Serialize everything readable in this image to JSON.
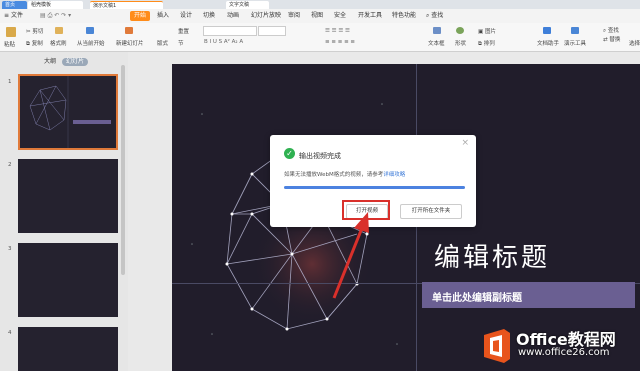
{
  "tabs": [
    {
      "label": "首页",
      "active": false
    },
    {
      "label": "稻壳模板",
      "active": false
    },
    {
      "label": "演示文稿1",
      "active": true
    },
    {
      "label": "文字文稿",
      "active": false
    }
  ],
  "menu": {
    "file_label": "文件",
    "items": [
      "开始",
      "插入",
      "设计",
      "切换",
      "动画",
      "幻灯片放映",
      "审阅",
      "视图",
      "安全",
      "开发工具",
      "特色功能"
    ],
    "active_item": "开始",
    "search_label": "查找"
  },
  "toolbar": {
    "paste": "粘贴",
    "cut": "剪切",
    "copy": "复制",
    "format_painter": "格式刷",
    "from_current": "从当前开始",
    "new_slide": "新建幻灯片",
    "layout": "版式",
    "reset": "重置",
    "section": "节",
    "textbox": "文本框",
    "shape": "形状",
    "picture": "图片",
    "arrange": "排列",
    "doc_helper": "文档助手",
    "presentation_tools": "演示工具",
    "find": "查找",
    "replace": "替换",
    "select": "选择"
  },
  "panel": {
    "tab_outline": "大纲",
    "tab_slides": "幻灯片",
    "thumb_numbers": [
      "1",
      "2",
      "3",
      "4"
    ]
  },
  "slide": {
    "title": "编辑标题",
    "subtitle": "单击此处编辑副标题"
  },
  "dialog": {
    "title": "输出视频完成",
    "message": "如果无法播放WebM格式的视频，请参考",
    "link": "详细攻略",
    "progress": 1.0,
    "open_video": "打开视频",
    "open_folder": "打开所在文件夹"
  },
  "watermark": {
    "brand": "Office教程网",
    "url": "www.office26.com"
  },
  "colors": {
    "accent": "#ff8c1a",
    "slide_bg": "#211d2b",
    "subtitle_bar": "#6a5f92",
    "success": "#2fb151",
    "progress": "#4c82e0",
    "highlight": "#d9302b",
    "logo_orange": "#e8541c"
  }
}
